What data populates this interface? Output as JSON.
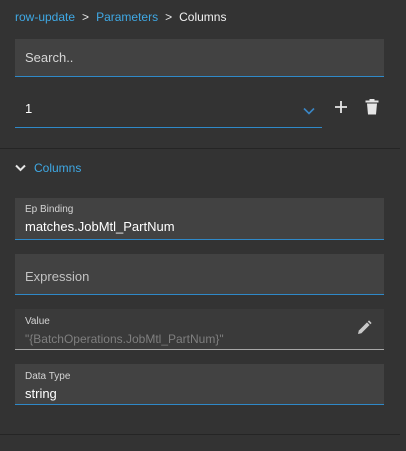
{
  "breadcrumb": {
    "items": [
      "row-update",
      "Parameters"
    ],
    "separator": ">",
    "current": "Columns"
  },
  "search": {
    "placeholder": "Search..",
    "value": ""
  },
  "selector": {
    "value": "1"
  },
  "icons": {
    "chevron": "chevron-down-icon",
    "add": "plus-icon",
    "delete": "trash-icon",
    "collapse": "chevron-down-icon",
    "edit": "pencil-icon"
  },
  "section": {
    "title": "Columns",
    "expanded": true
  },
  "fields": {
    "ep_binding": {
      "label": "Ep Binding",
      "value": "matches.JobMtl_PartNum"
    },
    "expression": {
      "placeholder": "Expression",
      "value": ""
    },
    "value": {
      "label": "Value",
      "value": "\"{BatchOperations.JobMtl_PartNum}\"",
      "disabled": true
    },
    "data_type": {
      "label": "Data Type",
      "value": "string"
    }
  },
  "colors": {
    "background": "#333333",
    "field": "#424242",
    "accent": "#3fa9e5",
    "underline": "#2f89c8"
  }
}
